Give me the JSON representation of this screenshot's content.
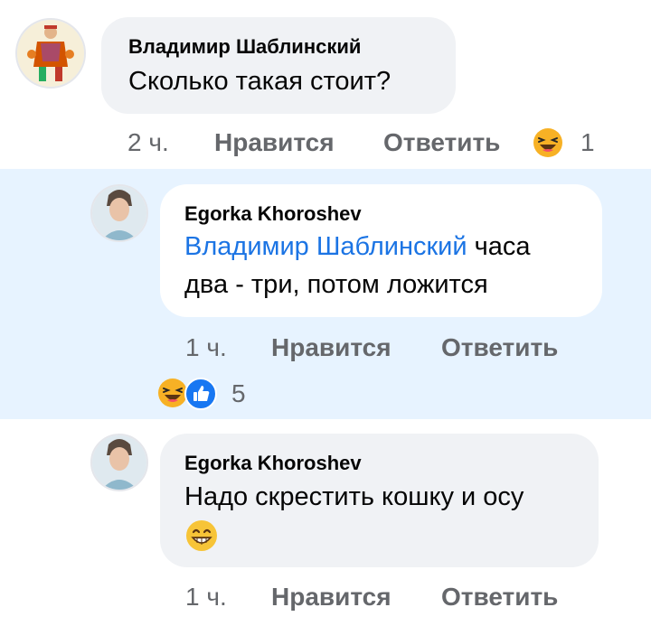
{
  "comments": [
    {
      "author": "Владимир Шаблинский",
      "text": "Сколько такая стоит?",
      "time": "2 ч.",
      "like_label": "Нравится",
      "reply_label": "Ответить",
      "reaction_icon": "haha-icon",
      "reaction_count": "1"
    },
    {
      "author": "Egorka Khoroshev",
      "mention": "Владимир Шаблинский",
      "text_line1": "часа",
      "text_line2": "два - три, потом ложится",
      "time": "1 ч.",
      "like_label": "Нравится",
      "reply_label": "Ответить",
      "reaction_icons": [
        "haha-icon",
        "like-icon"
      ],
      "reaction_count": "5"
    },
    {
      "author": "Egorka Khoroshev",
      "text": "Надо скрестить кошку и осу",
      "emoji": "😁",
      "time": "1 ч.",
      "like_label": "Нравится",
      "reply_label": "Ответить"
    }
  ],
  "colors": {
    "highlight_bg": "#e7f3ff",
    "bubble_bg": "#f0f2f5",
    "mention": "#1b74e4",
    "meta": "#65676b",
    "like_blue": "#1877f2",
    "haha_yellow": "#f7b125"
  }
}
